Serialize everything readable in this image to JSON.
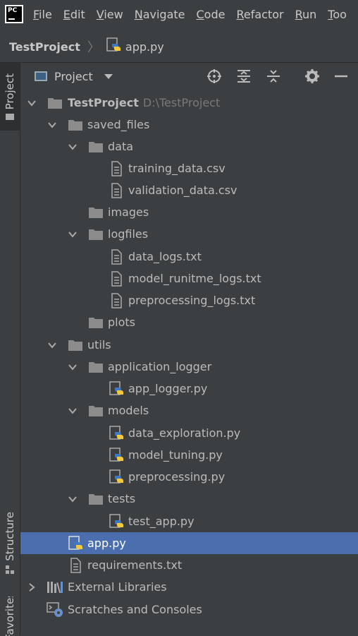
{
  "menubar": {
    "items": [
      {
        "label": "File",
        "mnemonic": "F",
        "rest": "ile"
      },
      {
        "label": "Edit",
        "mnemonic": "E",
        "rest": "dit"
      },
      {
        "label": "View",
        "mnemonic": "V",
        "rest": "iew"
      },
      {
        "label": "Navigate",
        "mnemonic": "N",
        "rest": "avigate"
      },
      {
        "label": "Code",
        "mnemonic": "C",
        "rest": "ode"
      },
      {
        "label": "Refactor",
        "mnemonic": "R",
        "rest": "efactor"
      },
      {
        "label": "Run",
        "mnemonic": "R",
        "rest": "un"
      },
      {
        "label": "Tools",
        "mnemonic": "T",
        "rest": "oo"
      }
    ]
  },
  "breadcrumb": {
    "project": "TestProject",
    "file": "app.py"
  },
  "stripe": {
    "project": "Project",
    "structure": "Structure",
    "favorites": "Favorites"
  },
  "toolwindow": {
    "view_label": "Project"
  },
  "tree": {
    "root": {
      "name": "TestProject",
      "path": "D:\\TestProject"
    },
    "saved_files": "saved_files",
    "data": "data",
    "training_data": "training_data.csv",
    "validation_data": "validation_data.csv",
    "images": "images",
    "logfiles": "logfiles",
    "data_logs": "data_logs.txt",
    "model_runtime_logs": "model_runitme_logs.txt",
    "preprocessing_logs": "preprocessing_logs.txt",
    "plots": "plots",
    "utils": "utils",
    "application_logger": "application_logger",
    "app_logger": "app_logger.py",
    "models": "models",
    "data_exploration": "data_exploration.py",
    "model_tuning": "model_tuning.py",
    "preprocessing": "preprocessing.py",
    "tests": "tests",
    "test_app": "test_app.py",
    "app": "app.py",
    "requirements": "requirements.txt",
    "external_libraries": "External Libraries",
    "scratches": "Scratches and Consoles"
  },
  "colors": {
    "background": "#3c3f41",
    "selection": "#4b6eaf",
    "folder": "#8c8c8c",
    "text": "#bbbbbb"
  }
}
